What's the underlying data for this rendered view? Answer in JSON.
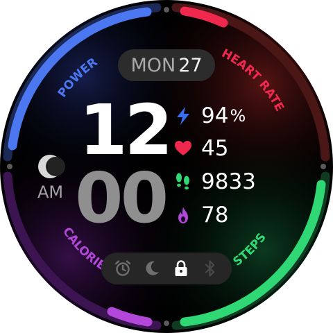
{
  "date": {
    "day": "MON",
    "num": "27"
  },
  "time": {
    "hour": "12",
    "minute": "00",
    "ampm": "AM"
  },
  "arcs": {
    "power": {
      "label": "POWER",
      "color": "#4b78f0"
    },
    "heart_rate": {
      "label": "HEART RATE",
      "color": "#f0284e"
    },
    "calorie": {
      "label": "CALORIE",
      "color": "#b347d9"
    },
    "steps": {
      "label": "STEPS",
      "color": "#2fd875"
    }
  },
  "stats": {
    "battery": {
      "value": "94",
      "unit": "%",
      "icon": "lightning-icon",
      "color": "#3a6ef0"
    },
    "heart": {
      "value": "45",
      "icon": "heart-icon",
      "color": "#f0284e"
    },
    "steps": {
      "value": "9833",
      "icon": "footsteps-icon",
      "color": "#2fd875"
    },
    "calories": {
      "value": "78",
      "icon": "flame-icon",
      "color": "#b347d9"
    }
  },
  "status_icons": [
    "alarm-clock-icon",
    "moon-icon",
    "lock-icon",
    "bluetooth-icon"
  ]
}
